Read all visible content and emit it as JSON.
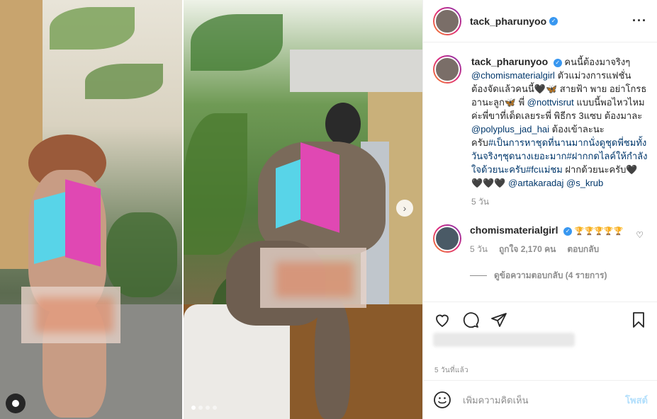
{
  "post": {
    "author": "tack_pharunyoo",
    "caption_parts": [
      {
        "type": "text",
        "value": "คนนี้ต้องมาจริงๆ "
      },
      {
        "type": "mention",
        "value": "@chomismaterialgirl"
      },
      {
        "type": "text",
        "value": " ตัวแม่วงการแฟชั่น ต้องจัดแล้วคนนี้🖤🦋 สายฟ้า พาย อย่าโกรธอานะลูก🦋 พี่ "
      },
      {
        "type": "mention",
        "value": "@nottvisrut"
      },
      {
        "type": "text",
        "value": " แบบนี้พอไหวไหมค่ะพี่ขาที่เด็ดเลยระพี่ พิธีกร 3แซบ ต้องมาละ "
      },
      {
        "type": "mention",
        "value": "@polyplus_jad_hai"
      },
      {
        "type": "text",
        "value": " ต้องเข้าละนะครับ"
      },
      {
        "type": "mention",
        "value": "#เป็นการหาชุดที่นานมากนั่งดูชุดพี่ชมทั้งวันจริงๆชุดนางเยอะมาก"
      },
      {
        "type": "mention",
        "value": "#ฝากกดไลค์ให้กำลังใจด้วยนะครับ"
      },
      {
        "type": "mention",
        "value": "#fcแม่ชม"
      },
      {
        "type": "text",
        "value": " ฝากด้วยนะครับ🖤🖤🖤🖤 "
      },
      {
        "type": "mention",
        "value": "@artakaradaj"
      },
      {
        "type": "text",
        "value": " "
      },
      {
        "type": "mention",
        "value": "@s_krub"
      }
    ],
    "caption_time": "5 วัน",
    "time_ago": "5 วันที่แล้ว"
  },
  "comment": {
    "author": "chomismaterialgirl",
    "text": "🏆🏆🏆🏆🏆",
    "time": "5 วัน",
    "likes": "ถูกใจ 2,170 คน",
    "reply": "ตอบกลับ",
    "view_replies": "ดูข้อความตอบกลับ (4 รายการ)"
  },
  "add_comment": {
    "placeholder": "เพิ่มความคิดเห็น",
    "post_label": "โพสต์"
  },
  "carousel": {
    "count": 4,
    "active": 0
  },
  "colors": {
    "verified": "#3897f0",
    "mention": "#00376b",
    "post_disabled": "#b2dffc"
  }
}
